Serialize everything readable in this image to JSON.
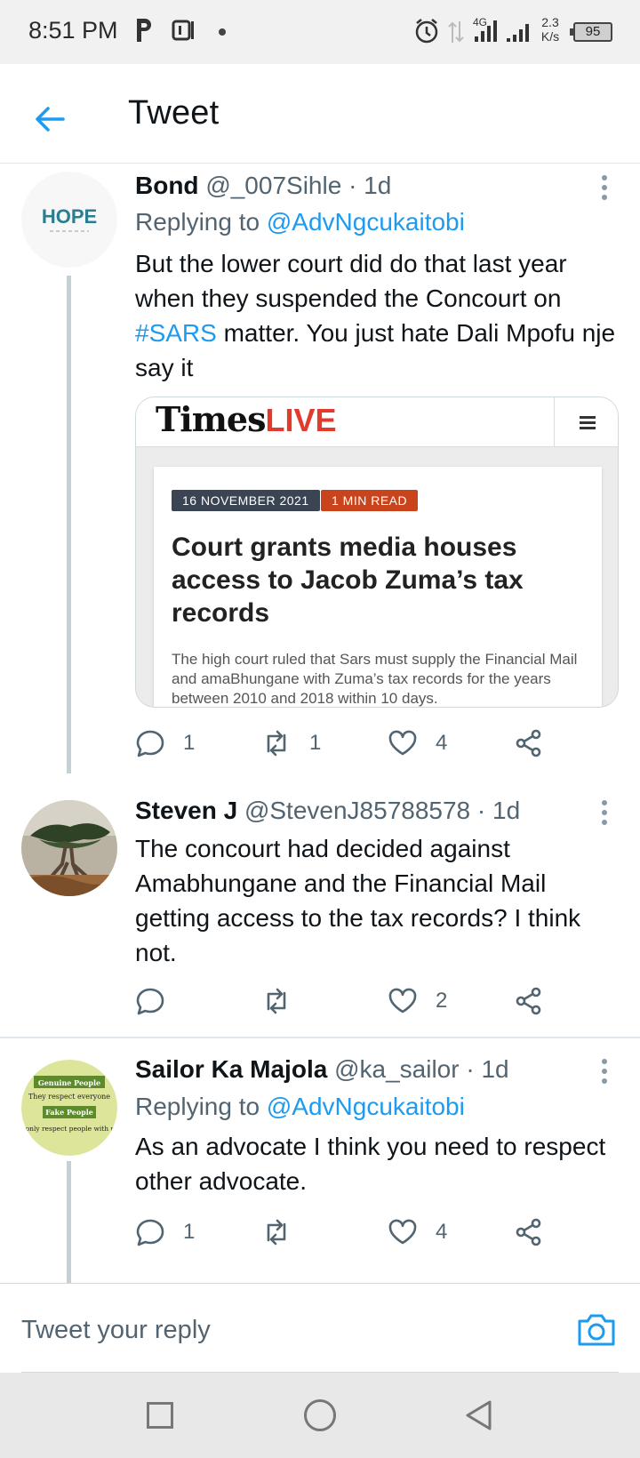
{
  "status_bar": {
    "time": "8:51 PM",
    "network": "4G",
    "speed_value": "2.3",
    "speed_unit": "K/s",
    "battery": "95"
  },
  "header": {
    "title": "Tweet",
    "back_icon": "arrow-left-icon"
  },
  "colors": {
    "accent": "#1d9bf0",
    "muted": "#536471",
    "thread_line": "#c4cfd6"
  },
  "tweets": [
    {
      "name": "Bond",
      "handle": "@_007Sihle",
      "time": "· 1d",
      "replying_prefix": "Replying to ",
      "replying_to": "@AdvNgcukaitobi",
      "body_before": "But the lower court did do that last year when they suspended the Concourt on ",
      "hashtag": "#SARS",
      "body_after": " matter. You just hate Dali Mpofu nje say it",
      "avatar_text": "HOPE",
      "card": {
        "site_name": "Times",
        "site_live": "LIVE",
        "date_tag": "16 NOVEMBER 2021",
        "read_tag": "1 MIN READ",
        "title": "Court grants media houses access to Jacob Zuma’s tax records",
        "summary": "The high court ruled that Sars must supply the Financial Mail and amaBhungane with Zuma’s tax records for the years between 2010 and 2018 within 10 days."
      },
      "replies": "1",
      "retweets": "1",
      "likes": "4"
    },
    {
      "name": "Steven J",
      "handle": "@StevenJ85788578",
      "time": "· 1d",
      "body": "The concourt had decided against Amabhungane and the Financial Mail getting access to the tax records? I think not.",
      "replies": "",
      "retweets": "",
      "likes": "2"
    },
    {
      "name": "Sailor Ka Majola",
      "handle": "@ka_sailor",
      "time": "· 1d",
      "replying_prefix": "Replying to ",
      "replying_to": "@AdvNgcukaitobi",
      "body": "As an advocate I think you need to respect other advocate.",
      "avatar_lines": [
        "Genuine People",
        "They respect everyone",
        "Fake People",
        "They only respect people with power"
      ],
      "replies": "1",
      "retweets": "",
      "likes": "4"
    }
  ],
  "reply_bar": {
    "placeholder": "Tweet your reply",
    "camera_icon": "camera-icon"
  },
  "nav_bar": {
    "recents": "square-icon",
    "home": "circle-icon",
    "back": "triangle-back-icon"
  }
}
